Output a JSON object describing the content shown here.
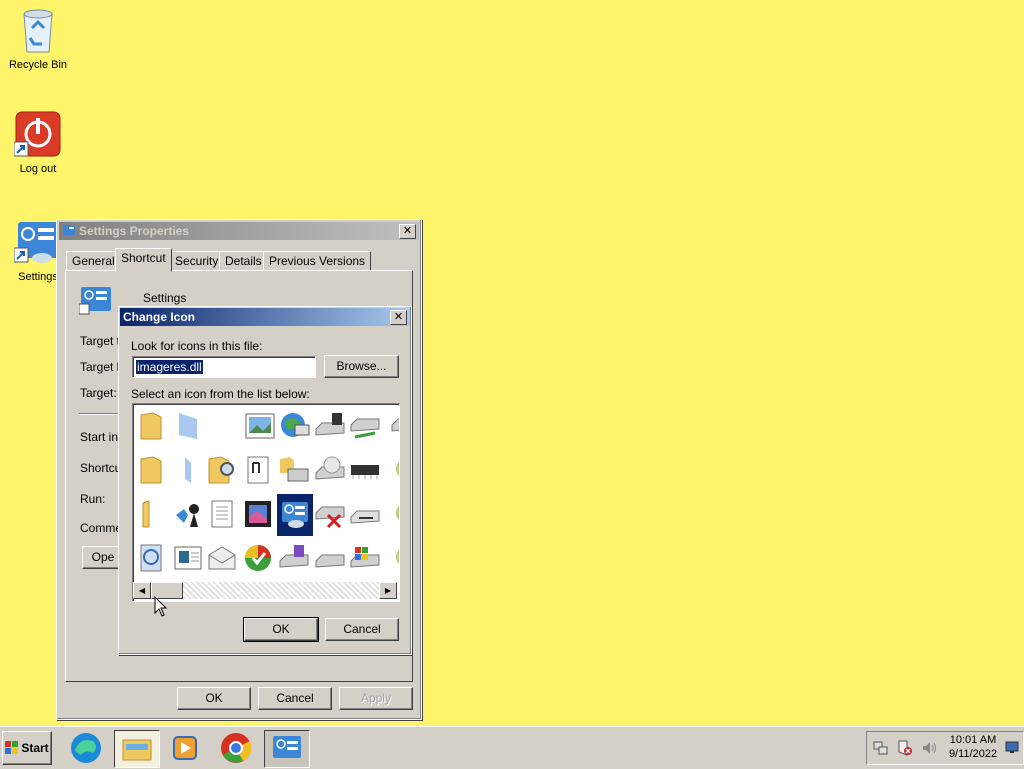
{
  "desktop": {
    "icons": [
      {
        "label": "Recycle Bin"
      },
      {
        "label": "Log out"
      },
      {
        "label": "Settings"
      }
    ]
  },
  "properties_window": {
    "title": "Settings Properties",
    "tabs": [
      "General",
      "Shortcut",
      "Security",
      "Details",
      "Previous Versions"
    ],
    "shortcut_name": "Settings",
    "labels": {
      "target_type": "Target ty",
      "target_location": "Target lo",
      "target": "Target:",
      "start_in": "Start in:",
      "shortcut_key": "Shortcut",
      "run": "Run:",
      "comment": "Commen",
      "open_button": "Ope"
    },
    "buttons": {
      "ok": "OK",
      "cancel": "Cancel",
      "apply": "Apply"
    }
  },
  "change_icon_dialog": {
    "title": "Change Icon",
    "file_label": "Look for icons in this file:",
    "file_value": "imageres.dll",
    "browse_button": "Browse...",
    "list_label": "Select an icon from the list below:",
    "buttons": {
      "ok": "OK",
      "cancel": "Cancel"
    },
    "selected_icon": "settings-app-icon"
  },
  "taskbar": {
    "start_label": "Start",
    "apps": [
      "edge-icon",
      "file-explorer-icon",
      "media-player-icon",
      "chrome-icon",
      "settings-app-icon"
    ],
    "clock_time": "10:01 AM",
    "clock_date": "9/11/2022"
  },
  "colors": {
    "desktop": "#fff56b",
    "title_active": "#0a246a",
    "title_inactive": "#808080",
    "face": "#d4d0c8",
    "selection": "#0a246a"
  }
}
